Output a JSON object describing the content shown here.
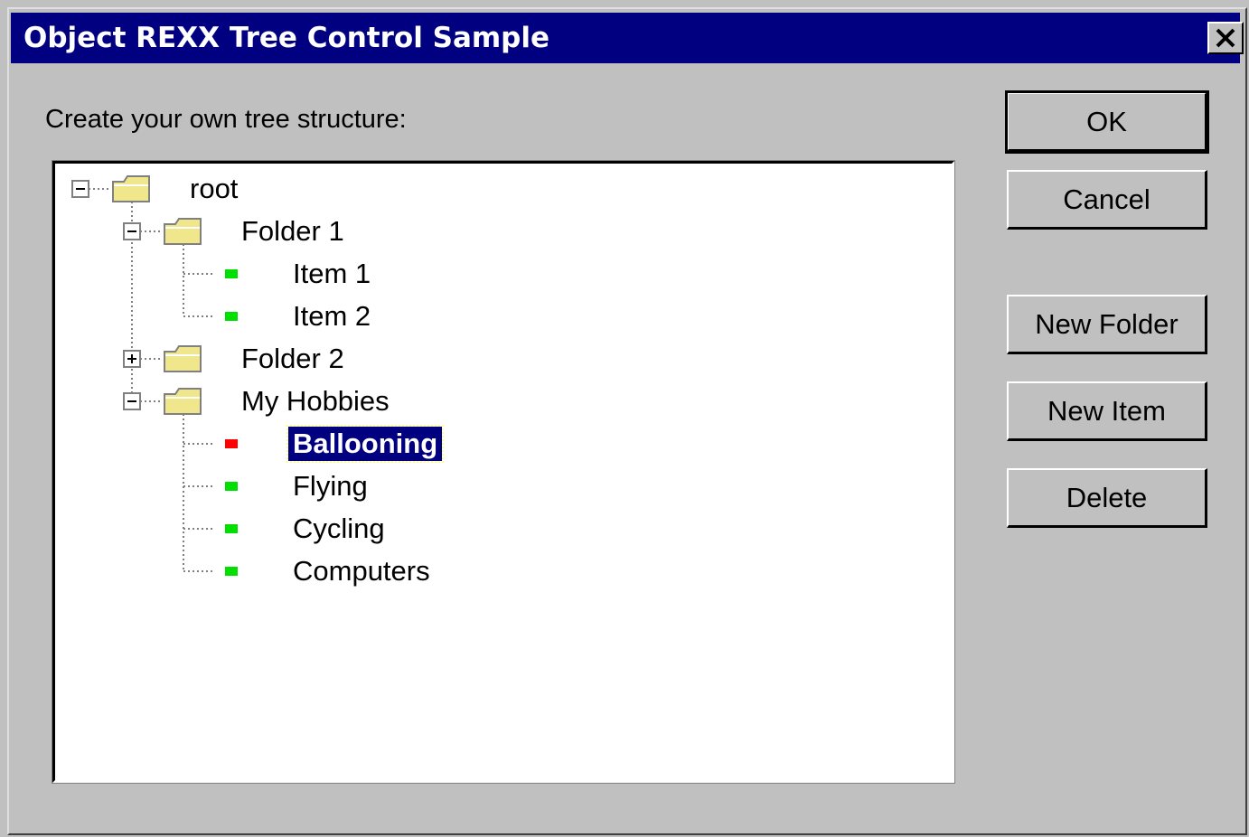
{
  "window": {
    "title": "Object REXX Tree Control Sample",
    "close_symbol": "✕"
  },
  "prompt_label": "Create your own tree structure:",
  "tree": {
    "nodes": [
      {
        "label": "root",
        "type": "folder",
        "depth": 0,
        "expander": "minus"
      },
      {
        "label": "Folder 1",
        "type": "folder",
        "depth": 1,
        "expander": "minus"
      },
      {
        "label": "Item 1",
        "type": "item",
        "depth": 2,
        "marker_color": "#00e000"
      },
      {
        "label": "Item 2",
        "type": "item",
        "depth": 2,
        "marker_color": "#00e000"
      },
      {
        "label": "Folder 2",
        "type": "folder",
        "depth": 1,
        "expander": "plus"
      },
      {
        "label": "My Hobbies",
        "type": "folder",
        "depth": 1,
        "expander": "minus"
      },
      {
        "label": "Ballooning",
        "type": "item",
        "depth": 2,
        "marker_color": "#ff0000",
        "selected": true
      },
      {
        "label": "Flying",
        "type": "item",
        "depth": 2,
        "marker_color": "#00e000"
      },
      {
        "label": "Cycling",
        "type": "item",
        "depth": 2,
        "marker_color": "#00e000"
      },
      {
        "label": "Computers",
        "type": "item",
        "depth": 2,
        "marker_color": "#00e000"
      }
    ]
  },
  "buttons": {
    "ok": "OK",
    "cancel": "Cancel",
    "new_folder": "New Folder",
    "new_item": "New Item",
    "delete": "Delete"
  },
  "colors": {
    "title_bar": "#000080",
    "dialog_bg": "#c0c0c0",
    "selection_bg": "#000080",
    "folder_fill": "#f0e68c",
    "item_marker": "#00e000",
    "selected_marker": "#ff0000"
  }
}
